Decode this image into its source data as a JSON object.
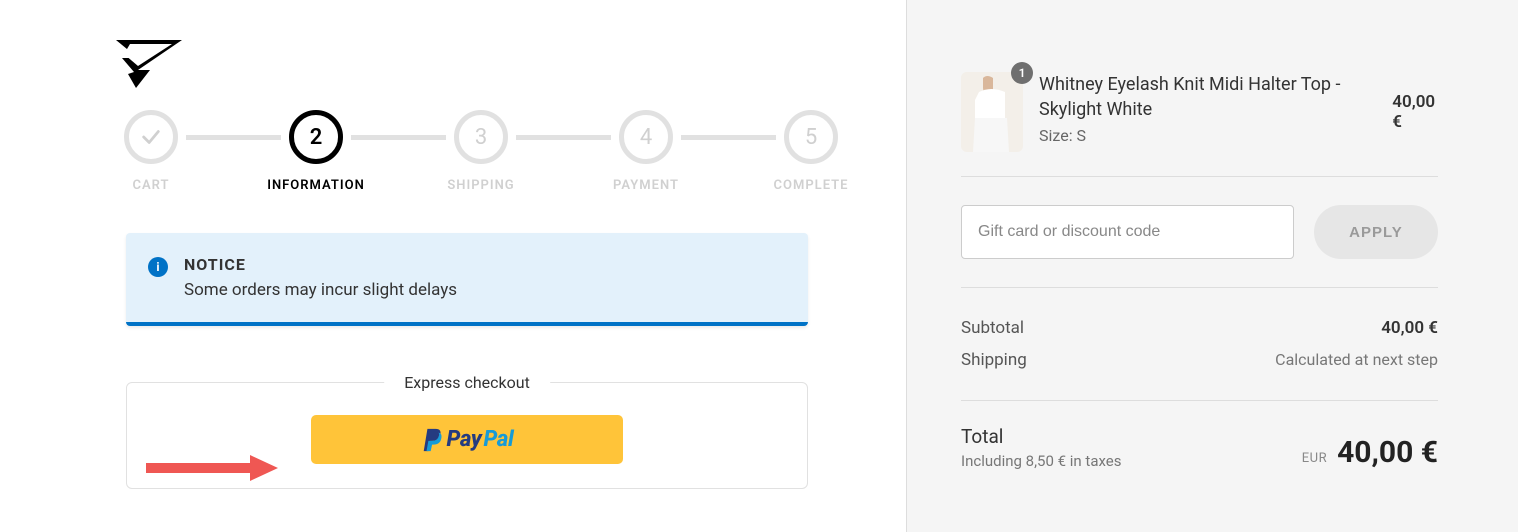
{
  "stepper": {
    "steps": [
      {
        "label": "CART",
        "state": "done"
      },
      {
        "label": "INFORMATION",
        "number": "2",
        "state": "active"
      },
      {
        "label": "SHIPPING",
        "number": "3",
        "state": "upcoming"
      },
      {
        "label": "PAYMENT",
        "number": "4",
        "state": "upcoming"
      },
      {
        "label": "COMPLETE",
        "number": "5",
        "state": "upcoming"
      }
    ]
  },
  "notice": {
    "title": "NOTICE",
    "body": "Some orders may incur slight delays"
  },
  "express": {
    "legend": "Express checkout",
    "paypal_pay": "Pay",
    "paypal_pal": "Pal"
  },
  "cart": {
    "item": {
      "qty": "1",
      "title": "Whitney Eyelash Knit Midi Halter Top - Skylight White",
      "option_label": "Size: S",
      "price": "40,00 €"
    }
  },
  "promo": {
    "placeholder": "Gift card or discount code",
    "apply": "APPLY"
  },
  "summary": {
    "subtotal_label": "Subtotal",
    "subtotal_value": "40,00 €",
    "shipping_label": "Shipping",
    "shipping_value": "Calculated at next step"
  },
  "total": {
    "label": "Total",
    "tax_note": "Including 8,50 € in taxes",
    "currency": "EUR",
    "amount": "40,00 €"
  }
}
